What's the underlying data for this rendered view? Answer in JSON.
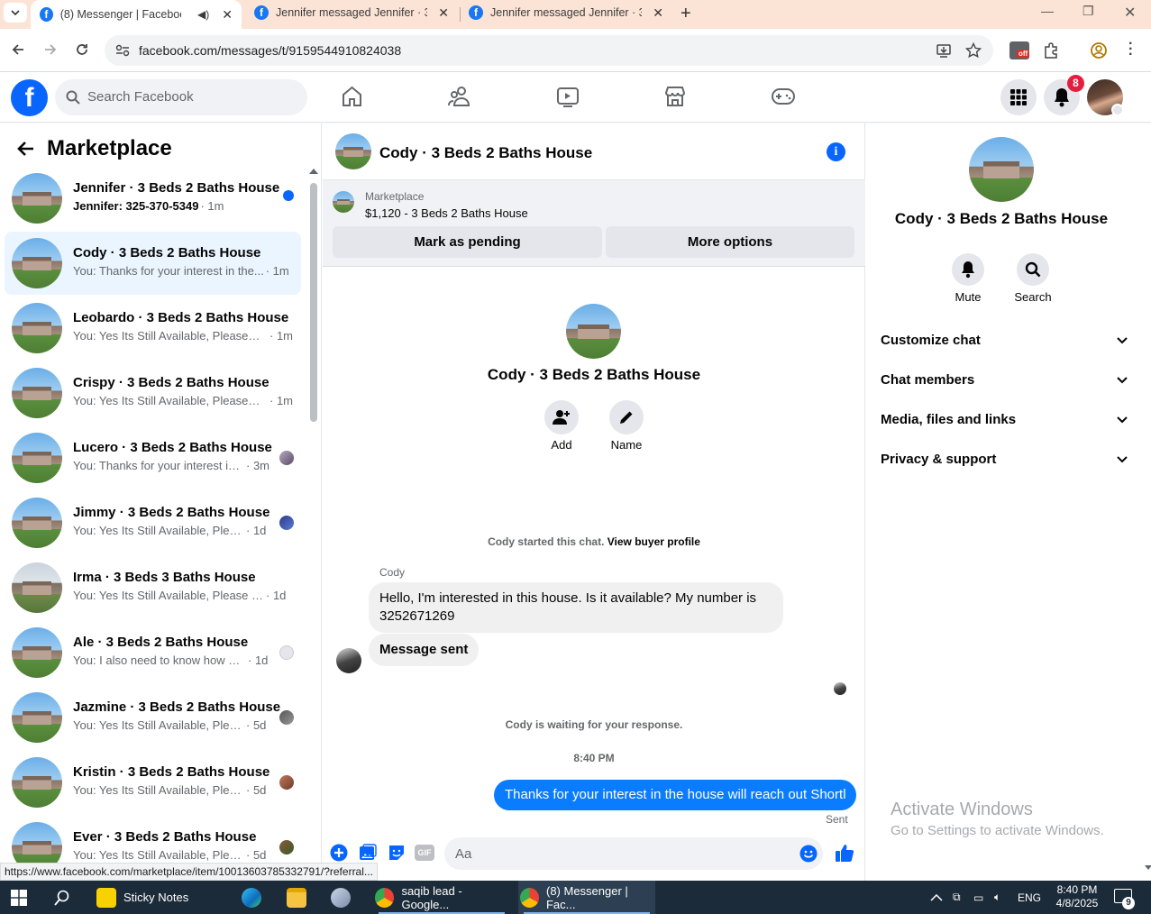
{
  "browser": {
    "tabs": [
      {
        "label": "(8) Messenger | Facebook",
        "active": true
      },
      {
        "label": "Jennifer messaged Jennifer · 3 B",
        "active": false
      },
      {
        "label": "Jennifer messaged Jennifer · 3 B",
        "active": false
      }
    ],
    "url": "facebook.com/messages/t/9159544910824038",
    "status_url": "https://www.facebook.com/marketplace/item/10013603785332791/?referral..."
  },
  "fb": {
    "search_placeholder": "Search Facebook",
    "notification_count": "8"
  },
  "left": {
    "title": "Marketplace",
    "conversations": [
      {
        "name": "Jennifer · 3 Beds 2 Baths House",
        "preview": "Jennifer: 325-370-5349",
        "time": " · 1m",
        "unread": true
      },
      {
        "name": "Cody · 3 Beds 2 Baths House",
        "preview": "You: Thanks for your interest in the...",
        "time": " · 1m",
        "selected": true
      },
      {
        "name": "Leobardo · 3 Beds 2 Baths House",
        "preview": "You: Yes Its Still Available, Please S...",
        "time": " · 1m"
      },
      {
        "name": "Crispy · 3 Beds 2 Baths House",
        "preview": "You: Yes Its Still Available, Please S...",
        "time": " · 1m"
      },
      {
        "name": "Lucero · 3 Beds 2 Baths House",
        "preview": "You: Thanks for your interest in ...",
        "time": " · 3m"
      },
      {
        "name": "Jimmy · 3 Beds 2 Baths House",
        "preview": "You: Yes Its Still Available, Please ...",
        "time": " · 1d"
      },
      {
        "name": "Irma · 3 Beds 3 Baths House",
        "preview": "You: Yes Its Still Available, Please Se...",
        "time": " · 1d"
      },
      {
        "name": "Ale · 3 Beds 2 Baths House",
        "preview": "You: I also need to know how m...",
        "time": " · 1d"
      },
      {
        "name": "Jazmine · 3 Beds 2 Baths House",
        "preview": "You: Yes Its Still Available, Please ...",
        "time": " · 5d"
      },
      {
        "name": "Kristin · 3 Beds 2 Baths House",
        "preview": "You: Yes Its Still Available, Please ...",
        "time": " · 5d"
      },
      {
        "name": "Ever · 3 Beds 2 Baths House",
        "preview": "You: Yes Its Still Available, Please ...",
        "time": " · 5d"
      }
    ]
  },
  "chat": {
    "title": "Cody · 3 Beds 2 Baths House",
    "marketplace_label": "Marketplace",
    "listing": "$1,120 - 3 Beds 2 Baths House",
    "mark_pending": "Mark as pending",
    "more_options": "More options",
    "add_label": "Add",
    "name_label": "Name",
    "started": "Cody started this chat.",
    "view_profile": "View buyer profile",
    "sender": "Cody",
    "incoming_1": "Hello, I'm interested in this house. Is it available? My number is 3252671269",
    "incoming_2": "Message sent",
    "waiting": "Cody is waiting for your response.",
    "time": "8:40 PM",
    "outgoing": "Thanks for your interest in the house will reach out Shortl",
    "sent": "Sent",
    "composer_placeholder": "Aa"
  },
  "right": {
    "name": "Cody · 3 Beds 2 Baths House",
    "mute": "Mute",
    "search": "Search",
    "sections": [
      "Customize chat",
      "Chat members",
      "Media, files and links",
      "Privacy & support"
    ],
    "activate_title": "Activate Windows",
    "activate_sub": "Go to Settings to activate Windows."
  },
  "taskbar": {
    "sticky": "Sticky Notes",
    "chrome1": "saqib lead - Google...",
    "chrome2": "(8) Messenger | Fac...",
    "lang": "ENG",
    "time": "8:40 PM",
    "date": "4/8/2025",
    "notif_count": "9"
  }
}
